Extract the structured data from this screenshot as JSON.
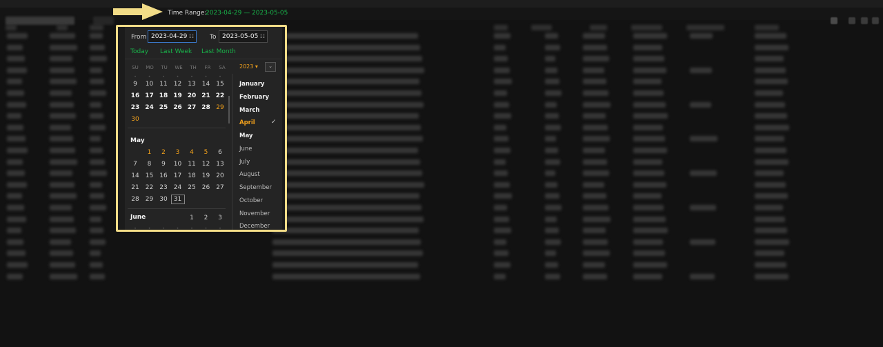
{
  "time_range": {
    "label": "Time Range:",
    "from": "2023-04-29",
    "dash": "—",
    "to": "2023-05-05"
  },
  "picker": {
    "from_label": "From",
    "from_value": "2023-04-29",
    "to_label": "To",
    "to_value": "2023-05-05",
    "field_icon": "calendar-icon",
    "quick_ranges": [
      "Today",
      "Last Week",
      "Last Month"
    ],
    "weekdays": [
      "SU",
      "MO",
      "TU",
      "WE",
      "TH",
      "FR",
      "SA"
    ],
    "year": "2023",
    "year_caret": "▾",
    "collapse_icon": "⌄",
    "april": {
      "rows": [
        [
          "9",
          "10",
          "11",
          "12",
          "13",
          "14",
          "15"
        ],
        [
          "16",
          "17",
          "18",
          "19",
          "20",
          "21",
          "22"
        ],
        [
          "23",
          "24",
          "25",
          "26",
          "27",
          "28",
          "29"
        ],
        [
          "30"
        ]
      ]
    },
    "may": {
      "title": "May",
      "rows": [
        [
          "",
          "1",
          "2",
          "3",
          "4",
          "5",
          "6"
        ],
        [
          "7",
          "8",
          "9",
          "10",
          "11",
          "12",
          "13"
        ],
        [
          "14",
          "15",
          "16",
          "17",
          "18",
          "19",
          "20"
        ],
        [
          "21",
          "22",
          "23",
          "24",
          "25",
          "26",
          "27"
        ],
        [
          "28",
          "29",
          "30",
          "31"
        ]
      ]
    },
    "june": {
      "title": "June",
      "first_row": [
        "",
        "",
        "",
        "",
        "1",
        "2",
        "3"
      ]
    },
    "months": [
      "January",
      "February",
      "March",
      "April",
      "May",
      "June",
      "July",
      "August",
      "September",
      "October",
      "November",
      "December"
    ],
    "selected_month": "April",
    "check": "✓"
  },
  "colors": {
    "accent_green": "#19b34a",
    "accent_orange": "#f0a01c",
    "highlight_border": "#f2dc87",
    "active_field_border": "#3a78c9"
  }
}
